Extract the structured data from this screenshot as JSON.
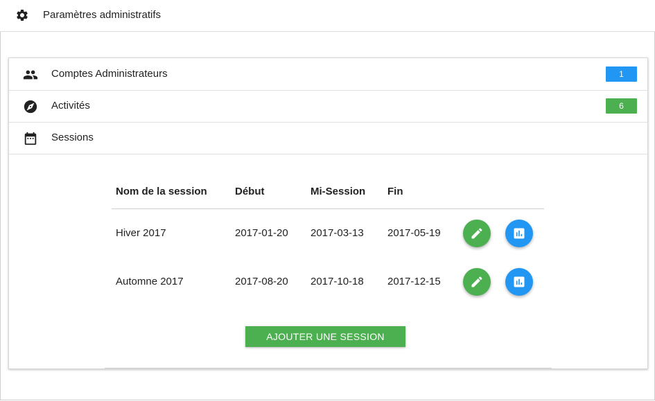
{
  "header": {
    "title": "Paramètres administratifs"
  },
  "sections": [
    {
      "label": "Comptes Administrateurs",
      "badge": "1",
      "badge_color": "#2196f3"
    },
    {
      "label": "Activités",
      "badge": "6",
      "badge_color": "#4caf50"
    },
    {
      "label": "Sessions"
    }
  ],
  "sessions_table": {
    "headers": [
      "Nom de la session",
      "Début",
      "Mi-Session",
      "Fin"
    ],
    "rows": [
      {
        "name": "Hiver 2017",
        "start": "2017-01-20",
        "mid": "2017-03-13",
        "end": "2017-05-19"
      },
      {
        "name": "Automne 2017",
        "start": "2017-08-20",
        "mid": "2017-10-18",
        "end": "2017-12-15"
      }
    ]
  },
  "actions": {
    "add_session_label": "AJOUTER UNE SESSION"
  },
  "colors": {
    "edit": "#4caf50",
    "stats": "#2196f3"
  }
}
